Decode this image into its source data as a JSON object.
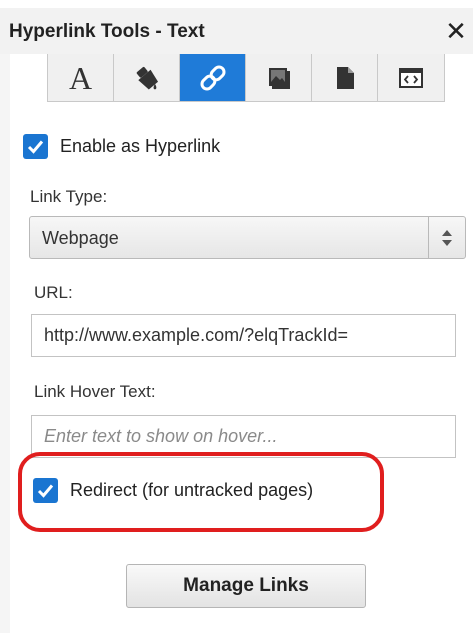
{
  "panel": {
    "title": "Hyperlink Tools - Text",
    "close_glyph": "✕"
  },
  "toolbar": {
    "tools": [
      {
        "name": "text-tool",
        "icon": "letter-a-icon",
        "glyph": "A",
        "active": false
      },
      {
        "name": "paint-tool",
        "icon": "paint-bucket-icon",
        "active": false
      },
      {
        "name": "link-tool",
        "icon": "link-icon",
        "active": true
      },
      {
        "name": "image-tool",
        "icon": "picture-icon",
        "active": false
      },
      {
        "name": "document-tool",
        "icon": "document-icon",
        "active": false
      },
      {
        "name": "code-tool",
        "icon": "code-window-icon",
        "active": false
      }
    ],
    "active_color": "#1f7bd8"
  },
  "enable_hyperlink": {
    "label": "Enable as Hyperlink",
    "checked": true
  },
  "link_type": {
    "label": "Link Type:",
    "selected": "Webpage"
  },
  "url": {
    "label": "URL:",
    "value": "http://www.example.com/?elqTrackId="
  },
  "hover_text": {
    "label": "Link Hover Text:",
    "value": "",
    "placeholder": "Enter text to show on hover..."
  },
  "redirect": {
    "label": "Redirect (for untracked pages)",
    "checked": true,
    "highlight_color": "#e01e1e"
  },
  "manage_links": {
    "label": "Manage Links"
  },
  "colors": {
    "checkbox": "#1a75d1"
  }
}
